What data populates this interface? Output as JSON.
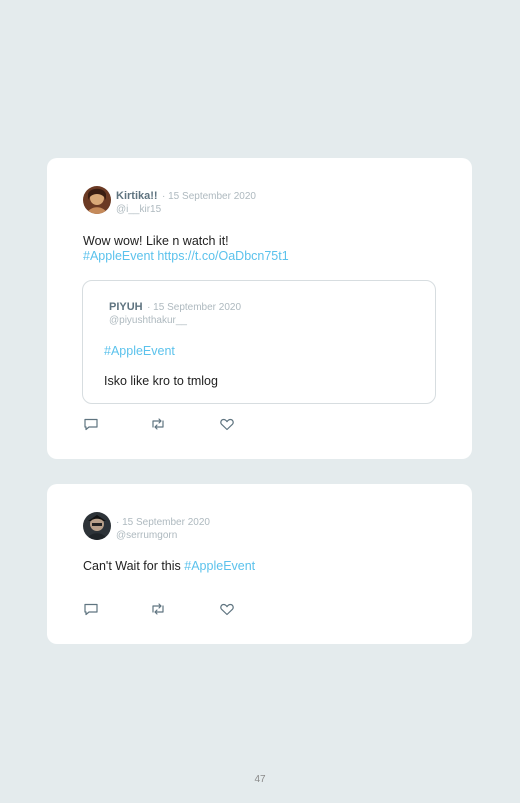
{
  "tweets": [
    {
      "name": "Kirtika!!",
      "date": "· 15 September 2020",
      "handle": "@i__kir15",
      "text_plain": "Wow wow! Like n watch it!",
      "text_link": "#AppleEvent https://t.co/OaDbcn75t1",
      "quoted": {
        "name": "PIYUH",
        "date": "· 15 September 2020",
        "handle": "@piyushthakur__",
        "hashtag": "#AppleEvent",
        "text": "Isko like kro to tmlog"
      },
      "actions": [
        "reply-icon",
        "retweet-icon",
        "like-icon"
      ]
    },
    {
      "name": "",
      "date": "· 15 September 2020",
      "handle": "@serrumgorn",
      "text_plain": "Can't Wait for this ",
      "text_link": "#AppleEvent",
      "actions": [
        "reply-icon",
        "retweet-icon",
        "like-icon"
      ]
    }
  ],
  "page_number": "47",
  "colors": {
    "background": "#e4ebed",
    "card": "#ffffff",
    "link": "#5bc2ec",
    "name": "#5f7480",
    "muted": "#aeb9bf"
  }
}
